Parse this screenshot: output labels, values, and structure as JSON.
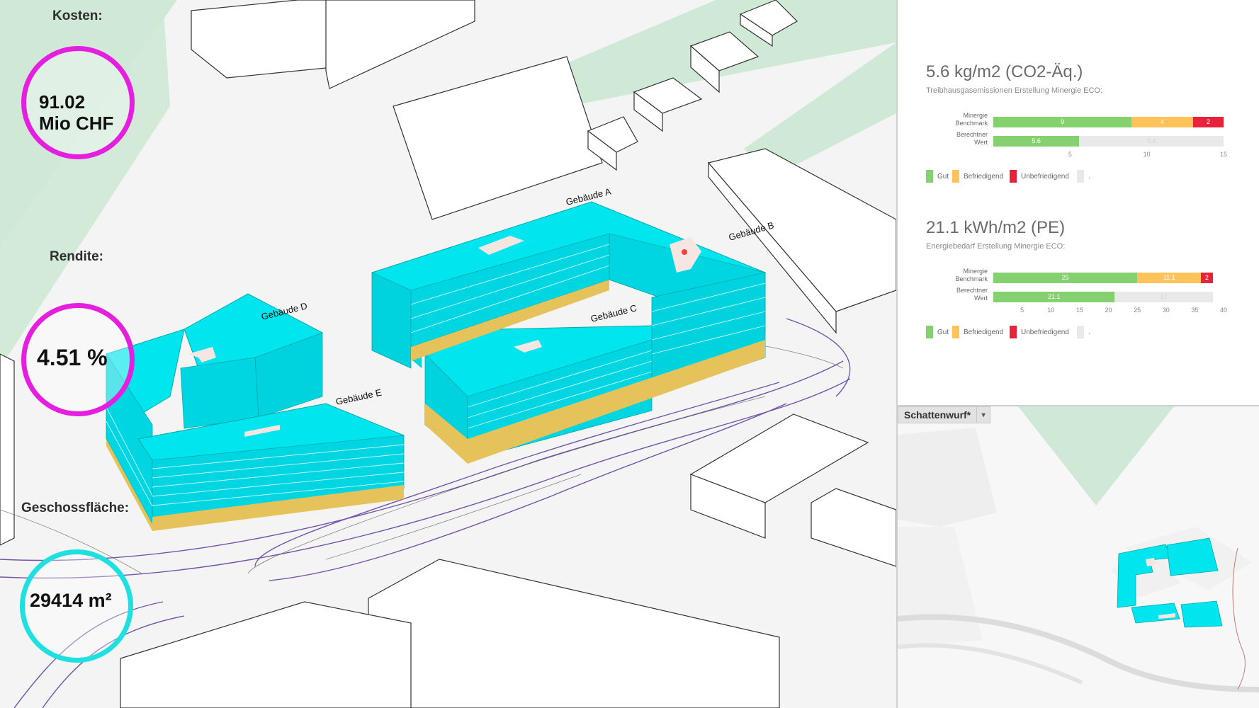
{
  "kpis": {
    "costs": {
      "label": "Kosten:",
      "value": "91.02\nMio CHF",
      "color": "#e61ee0"
    },
    "yield": {
      "label": "Rendite:",
      "value": "4.51 %",
      "color": "#e61ee0"
    },
    "floor_area": {
      "label": "Geschossfläche:",
      "value": "29414 m²",
      "color": "#1ee0e0"
    }
  },
  "buildings": {
    "a": "Gebäude A",
    "b": "Gebäude B",
    "c": "Gebäude C",
    "d": "Gebäude D",
    "e": "Gebäude E"
  },
  "colors": {
    "building": "#00e5ee",
    "plinth": "#e6c35a",
    "green": "#cfe9d6",
    "gut": "#86d16f",
    "befriedigend": "#ffc35a",
    "unbefriedigend": "#e8223a",
    "rest": "#e9e9e9"
  },
  "charts": {
    "ghg": {
      "title": "5.6 kg/m2 (CO2-Äq.)",
      "subtitle": "Treibhausgasemissionen Erstellung Minergie ECO:",
      "row1_label": "Minergie\nBenchmark",
      "row2_label": "Berechtner\nWert",
      "legend": [
        "Gut",
        "Befriedigend",
        "Unbefriedigend",
        "."
      ]
    },
    "energy": {
      "title": "21.1 kWh/m2 (PE)",
      "subtitle": "Energiebedarf Erstellung Minergie ECO:",
      "row1_label": "Minergie\nBenchmark",
      "row2_label": "Berechtner\nWert",
      "legend": [
        "Gut",
        "Befriedigend",
        "Unbefriedigend",
        "."
      ]
    }
  },
  "chart_data": [
    {
      "type": "bar",
      "title": "5.6 kg/m2 (CO2-Äq.)",
      "categories": [
        "Minergie Benchmark",
        "Berechtner Wert"
      ],
      "series": [
        {
          "name": "Gut",
          "values": [
            9,
            5.6
          ]
        },
        {
          "name": "Befriedigend",
          "values": [
            4,
            0
          ]
        },
        {
          "name": "Unbefriedigend",
          "values": [
            2,
            0
          ]
        },
        {
          "name": ".",
          "values": [
            0,
            9.4
          ]
        }
      ],
      "xticks": [
        5,
        10,
        15
      ],
      "xlim": [
        0,
        15
      ],
      "stacked": true,
      "orientation": "horizontal"
    },
    {
      "type": "bar",
      "title": "21.1 kWh/m2 (PE)",
      "categories": [
        "Minergie Benchmark",
        "Berechtner Wert"
      ],
      "series": [
        {
          "name": "Gut",
          "values": [
            25,
            21.1
          ]
        },
        {
          "name": "Befriedigend",
          "values": [
            11.1,
            0
          ]
        },
        {
          "name": "Unbefriedigend",
          "values": [
            2,
            0
          ]
        },
        {
          "name": ".",
          "values": [
            0,
            17
          ]
        }
      ],
      "xticks": [
        5,
        10,
        15,
        20,
        25,
        30,
        35,
        40
      ],
      "xlim": [
        0,
        40
      ],
      "stacked": true,
      "orientation": "horizontal"
    }
  ],
  "shadow_panel": {
    "tab_label": "Schattenwurf*",
    "dropdown_icon": "chevron-down-icon"
  }
}
